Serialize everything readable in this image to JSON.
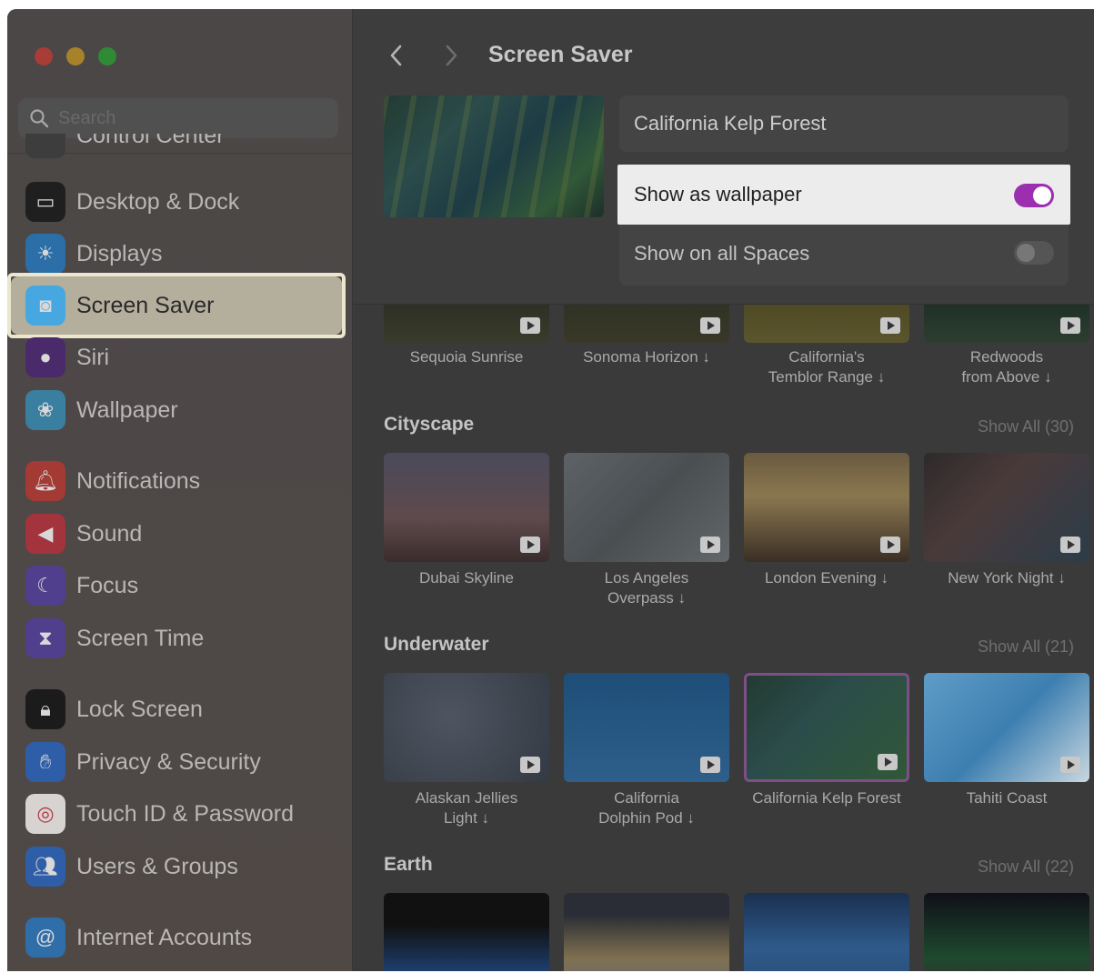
{
  "sidebar": {
    "search_placeholder": "Search",
    "partial_item": "Control Center",
    "items": [
      {
        "label": "Desktop & Dock",
        "icon": "dock-icon",
        "color": "#1f1f1f"
      },
      {
        "label": "Displays",
        "icon": "sun-icon",
        "color": "#2b6ea8"
      },
      {
        "label": "Screen Saver",
        "icon": "screensaver-icon",
        "color": "#47a7e0",
        "active": true
      },
      {
        "label": "Siri",
        "icon": "siri-icon",
        "color": "#4a2a6a"
      },
      {
        "label": "Wallpaper",
        "icon": "flower-icon",
        "color": "#3a7fa0"
      },
      {
        "label": "Notifications",
        "icon": "bell-icon",
        "color": "#a33a34"
      },
      {
        "label": "Sound",
        "icon": "speaker-icon",
        "color": "#a3333d"
      },
      {
        "label": "Focus",
        "icon": "moon-icon",
        "color": "#4f3f8d"
      },
      {
        "label": "Screen Time",
        "icon": "hourglass-icon",
        "color": "#4f3f8d"
      },
      {
        "label": "Lock Screen",
        "icon": "lock-icon",
        "color": "#1b1b1b"
      },
      {
        "label": "Privacy & Security",
        "icon": "hand-icon",
        "color": "#2f5ea8"
      },
      {
        "label": "Touch ID & Password",
        "icon": "fingerprint-icon",
        "color": "#d6d3d0"
      },
      {
        "label": "Users & Groups",
        "icon": "users-icon",
        "color": "#2f5ea8"
      },
      {
        "label": "Internet Accounts",
        "icon": "at-icon",
        "color": "#2f6ea8"
      }
    ]
  },
  "header": {
    "title": "Screen Saver",
    "back_icon": "chevron-left-icon",
    "forward_icon": "chevron-right-icon"
  },
  "settings": {
    "saver_name": "California Kelp Forest",
    "show_as_wallpaper": "Show as wallpaper",
    "show_as_wallpaper_on": true,
    "show_on_all_spaces": "Show on all Spaces",
    "show_on_all_spaces_on": false
  },
  "top_row": {
    "captions": [
      "Sequoia Sunrise",
      "Sonoma Horizon ↓",
      "California's\nTemblor Range ↓",
      "Redwoods\nfrom Above ↓"
    ]
  },
  "sections": [
    {
      "title": "Cityscape",
      "show_all": "Show All (30)",
      "captions": [
        "Dubai Skyline",
        "Los Angeles\nOverpass ↓",
        "London Evening ↓",
        "New York Night ↓"
      ]
    },
    {
      "title": "Underwater",
      "show_all": "Show All (21)",
      "captions": [
        "Alaskan Jellies\nLight ↓",
        "California\nDolphin Pod ↓",
        "California Kelp Forest",
        "Tahiti Coast"
      ]
    },
    {
      "title": "Earth",
      "show_all": "Show All (22)",
      "captions": []
    }
  ],
  "colors": {
    "accent_toggle": "#9b2fb0",
    "highlight_box": "#ebe6cd"
  }
}
